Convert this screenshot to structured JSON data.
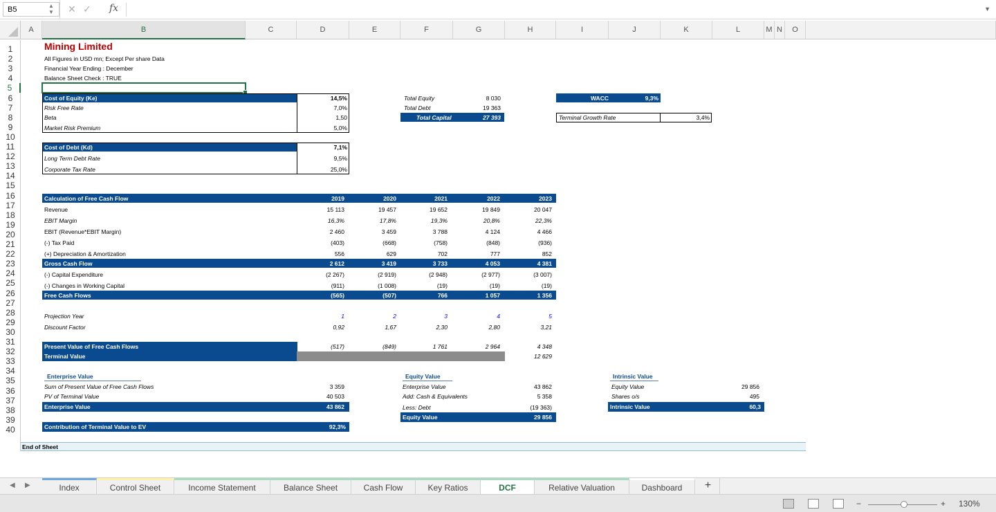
{
  "formula_bar": {
    "name_box": "B5",
    "fx": "fx",
    "cancel": "✕",
    "confirm": "✓",
    "formula": ""
  },
  "columns": [
    "A",
    "B",
    "C",
    "D",
    "E",
    "F",
    "G",
    "H",
    "I",
    "J",
    "K",
    "L",
    "M",
    "N",
    "O"
  ],
  "rows": [
    "1",
    "2",
    "3",
    "4",
    "5",
    "6",
    "7",
    "8",
    "9",
    "10",
    "11",
    "12",
    "13",
    "14",
    "15",
    "16",
    "17",
    "18",
    "19",
    "20",
    "21",
    "22",
    "23",
    "24",
    "25",
    "26",
    "27",
    "28",
    "29",
    "30",
    "31",
    "32",
    "33",
    "34",
    "35",
    "36",
    "37",
    "38",
    "39",
    "40"
  ],
  "header": {
    "title": "Mining Limited",
    "line2": "All Figures in USD mn; Except Per share Data",
    "line3": "Financial Year Ending : December",
    "line4": "Balance Sheet Check : TRUE"
  },
  "ke": {
    "label": "Cost of Equity (Ke)",
    "value": "14,5%",
    "rows": [
      {
        "label": "Risk Free Rate",
        "value": "7,0%"
      },
      {
        "label": "Beta",
        "value": "1,50"
      },
      {
        "label": "Market Risk Premium",
        "value": "5,0%"
      }
    ]
  },
  "capital": {
    "equity_label": "Total Equity",
    "equity": "8 030",
    "debt_label": "Total Debt",
    "debt": "19 363",
    "total_label": "Total Capital",
    "total": "27 393"
  },
  "wacc": {
    "label": "WACC",
    "value": "9,3%",
    "tg_label": "Terminal Growth Rate",
    "tg_value": "3,4%"
  },
  "kd": {
    "label": "Cost of Debt (Kd)",
    "value": "7,1%",
    "rows": [
      {
        "label": "Long Term Debt Rate",
        "value": "9,5%"
      },
      {
        "label": "Corporate Tax Rate",
        "value": "25,0%"
      }
    ]
  },
  "fcf": {
    "title": "Calculation of Free Cash Flow",
    "years": [
      "2019",
      "2020",
      "2021",
      "2022",
      "2023"
    ],
    "revenue": {
      "label": "Revenue",
      "values": [
        "15 113",
        "19 457",
        "19 652",
        "19 849",
        "20 047"
      ]
    },
    "ebit_margin": {
      "label": "EBIT Margin",
      "values": [
        "16,3%",
        "17,8%",
        "19,3%",
        "20,8%",
        "22,3%"
      ]
    },
    "ebit": {
      "label": "EBIT (Revenue*EBIT Margin)",
      "values": [
        "2 460",
        "3 459",
        "3 788",
        "4 124",
        "4 466"
      ]
    },
    "tax": {
      "label": "(-) Tax Paid",
      "values": [
        "(403)",
        "(668)",
        "(758)",
        "(848)",
        "(936)"
      ]
    },
    "da": {
      "label": "(+) Depreciation & Amortization",
      "values": [
        "556",
        "629",
        "702",
        "777",
        "852"
      ]
    },
    "gcf": {
      "label": "Gross Cash Flow",
      "values": [
        "2 612",
        "3 419",
        "3 733",
        "4 053",
        "4 381"
      ]
    },
    "capex": {
      "label": "(-) Capital Expenditure",
      "values": [
        "(2 267)",
        "(2 919)",
        "(2 948)",
        "(2 977)",
        "(3 007)"
      ]
    },
    "wc": {
      "label": "(-) Changes in Working Capital",
      "values": [
        "(911)",
        "(1 008)",
        "(19)",
        "(19)",
        "(19)"
      ]
    },
    "fcf": {
      "label": "Free Cash Flows",
      "values": [
        "(565)",
        "(507)",
        "766",
        "1 057",
        "1 356"
      ]
    },
    "proj": {
      "label": "Projection Year",
      "values": [
        "1",
        "2",
        "3",
        "4",
        "5"
      ]
    },
    "df": {
      "label": "Discount Factor",
      "values": [
        "0,92",
        "1,67",
        "2,30",
        "2,80",
        "3,21"
      ]
    },
    "pv": {
      "label": "Present Value of Free Cash Flows",
      "values": [
        "(517)",
        "(849)",
        "1 761",
        "2 964",
        "4 348"
      ]
    },
    "tv": {
      "label": "Terminal Value",
      "value": "12 629"
    }
  },
  "ev": {
    "title": "Enterprise Value",
    "sum_label": "Sum of Present Value of Free Cash Flows",
    "sum": "3 359",
    "pvtv_label": "PV of Terminal Value",
    "pvtv": "40 503",
    "ev_label": "Enterprise Value",
    "ev": "43 862",
    "contrib_label": "Contribution of Terminal Value to EV",
    "contrib": "92,3%"
  },
  "eqv": {
    "title": "Equity Value",
    "ev_label": "Enterprise Value",
    "ev": "43 862",
    "cash_label": "Add: Cash & Equivalents",
    "cash": "5 358",
    "debt_label": "Less: Debt",
    "debt": "(19 363)",
    "eq_label": "Equity Value",
    "eq": "29 856"
  },
  "iv": {
    "title": "Intrinsic Value",
    "eq_label": "Equity Value",
    "eq": "29 856",
    "sh_label": "Shares o/s",
    "sh": "495",
    "iv_label": "Intrinsic Value",
    "iv": "60,3"
  },
  "end_label": "End of Sheet",
  "tabs": [
    "Index",
    "Control Sheet",
    "Income Statement",
    "Balance Sheet",
    "Cash Flow",
    "Key Ratios",
    "DCF",
    "Relative Valuation",
    "Dashboard"
  ],
  "tab_colors": [
    "#6fa8dc",
    "#fff2a8",
    "#a8dcc0",
    "#a8dcc0",
    "#a8dcc0",
    "#a8dcc0",
    "#a8dcc0",
    "#a8dcc0",
    "#ffffff"
  ],
  "active_tab": "DCF",
  "add_sheet": "+",
  "zoom": "130%",
  "zoom_minus": "−",
  "zoom_plus": "+"
}
